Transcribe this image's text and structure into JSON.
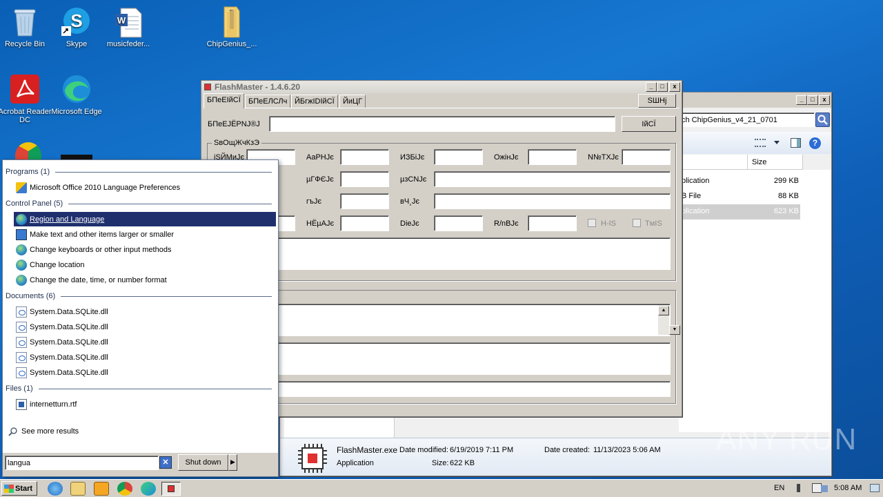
{
  "desktop": {
    "icons": [
      {
        "label": "Recycle Bin"
      },
      {
        "label": "Skype"
      },
      {
        "label": "musicfeder..."
      },
      {
        "label": "ChipGenius_..."
      },
      {
        "label": "Acrobat Reader DC"
      },
      {
        "label": "Microsoft Edge"
      }
    ]
  },
  "flashmaster": {
    "title": "FlashMaster - 1.4.6.20",
    "tabs": [
      "БПеЕІйСЇ",
      "БПеЕЛСЛч",
      "ЙБгжІDІйСЇ",
      "ЙиЦГ"
    ],
    "top_button": "SШНј",
    "device_label": "БПеЕJЁРNJ®J",
    "device_button": "ІйСЇ",
    "group_title": "SвОщЖчКзЭ",
    "row1": [
      "iSЙМиJє",
      "AаPHJє",
      "ИЗБіJє",
      "OжінJє",
      "N№ТХJє"
    ],
    "row2": [
      "µГФЄJє",
      "µзCNJє"
    ],
    "row3": [
      "гъJє",
      "вЧ¸Jє"
    ],
    "row4": [
      "HЁµAJє",
      "DіеJє",
      "R/nBJє"
    ],
    "check1": "H-IS",
    "check2": "TмIS"
  },
  "explorer": {
    "address": "ch ChipGenius_v4_21_0701",
    "col_size": "Size",
    "rows": [
      {
        "type": "plication",
        "size": "299 KB"
      },
      {
        "type": "B File",
        "size": "88 KB"
      },
      {
        "type": "plication",
        "size": "623 KB"
      }
    ],
    "details": {
      "filename": "FlashMaster.exe",
      "modified_label": "Date modified:",
      "modified_value": "6/19/2019 7:11 PM",
      "created_label": "Date created:",
      "created_value": "11/13/2023 5:06 AM",
      "type": "Application",
      "size_label": "Size:",
      "size_value": "622 KB"
    }
  },
  "startmenu": {
    "groups": [
      {
        "title": "Programs (1)",
        "items": [
          "Microsoft Office 2010 Language Preferences"
        ]
      },
      {
        "title": "Control Panel (5)",
        "items": [
          "Region and Language",
          "Make text and other items larger or smaller",
          "Change keyboards or other input methods",
          "Change location",
          "Change the date, time, or number format"
        ]
      },
      {
        "title": "Documents (6)",
        "items": [
          "System.Data.SQLite.dll",
          "System.Data.SQLite.dll",
          "System.Data.SQLite.dll",
          "System.Data.SQLite.dll",
          "System.Data.SQLite.dll"
        ]
      },
      {
        "title": "Files (1)",
        "items": [
          "internetturn.rtf"
        ]
      }
    ],
    "see_more": "See more results",
    "search_value": "langua",
    "shutdown": "Shut down"
  },
  "taskbar": {
    "start": "Start",
    "lang": "EN",
    "time": "5:08 AM"
  },
  "watermark": "ANY RUN"
}
